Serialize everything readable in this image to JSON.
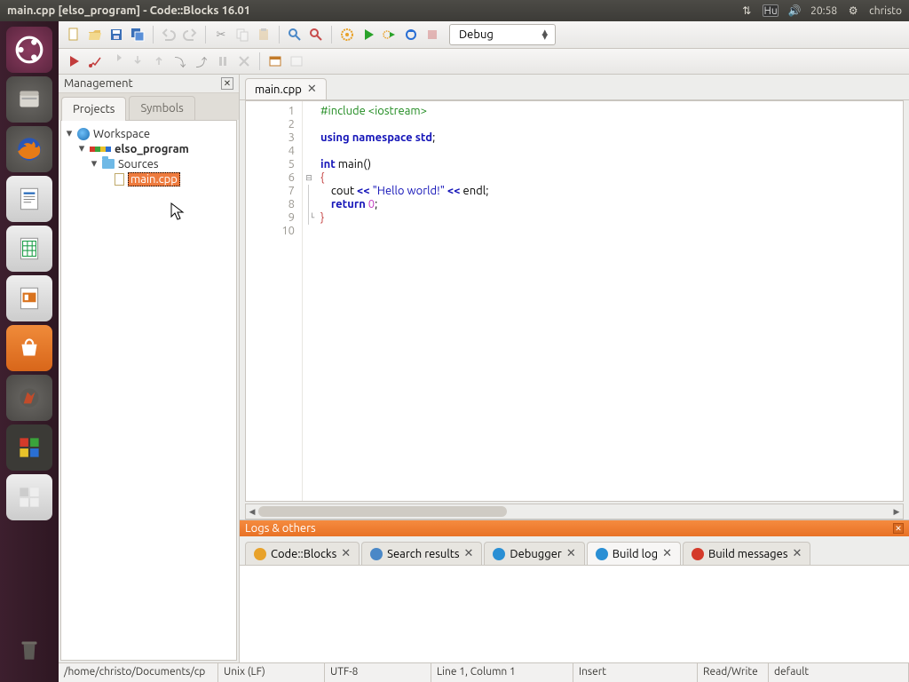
{
  "menubar": {
    "title": "main.cpp [elso_program] - Code::Blocks 16.01",
    "kb": "Hu",
    "time": "20:58",
    "user": "christo"
  },
  "toolbar": {
    "build_target": "Debug"
  },
  "management": {
    "title": "Management",
    "tabs": {
      "projects": "Projects",
      "symbols": "Symbols"
    },
    "tree": {
      "workspace": "Workspace",
      "project": "elso_program",
      "sources": "Sources",
      "file": "main.cpp"
    }
  },
  "editor": {
    "tab": "main.cpp",
    "lines": [
      "1",
      "2",
      "3",
      "4",
      "5",
      "6",
      "7",
      "8",
      "9",
      "10"
    ],
    "code": {
      "l1a": "#include ",
      "l1b": "<iostream>",
      "l3a": "using",
      "l3b": " namespace ",
      "l3c": "std",
      "l3d": ";",
      "l5a": "int",
      "l5b": " main",
      "l5c": "()",
      "l6": "{",
      "l7a": "    cout ",
      "l7b": "<<",
      "l7c": " \"Hello world!\" ",
      "l7d": "<<",
      "l7e": " endl",
      "l7f": ";",
      "l8a": "    ",
      "l8b": "return",
      "l8c": " ",
      "l8d": "0",
      "l8e": ";",
      "l9": "}"
    }
  },
  "logs": {
    "title": "Logs & others",
    "tabs": {
      "cb": "Code::Blocks",
      "search": "Search results",
      "dbg": "Debugger",
      "build": "Build log",
      "msg": "Build messages"
    }
  },
  "status": {
    "path": "/home/christo/Documents/cp",
    "eol": "Unix (LF)",
    "enc": "UTF-8",
    "pos": "Line 1, Column 1",
    "mode": "Insert",
    "rw": "Read/Write",
    "profile": "default"
  }
}
